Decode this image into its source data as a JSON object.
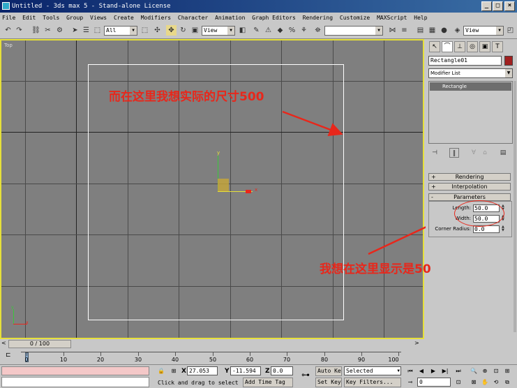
{
  "window": {
    "title": "Untitled - 3ds max 5 - Stand-alone License",
    "min": "_",
    "max": "□",
    "close": "×"
  },
  "menu": [
    "File",
    "Edit",
    "Tools",
    "Group",
    "Views",
    "Create",
    "Modifiers",
    "Character",
    "Animation",
    "Graph Editors",
    "Rendering",
    "Customize",
    "MAXScript",
    "Help"
  ],
  "toolbar": {
    "selection_filter": "All",
    "ref_coord": "View",
    "ref_coord_right": "View"
  },
  "viewport": {
    "label": "Top",
    "axis_x": "x",
    "axis_y": "y"
  },
  "annotations": {
    "top": "而在这里我想实际的尺寸500",
    "bottom": "我想在这里显示是50"
  },
  "command_panel": {
    "object_name": "Rectangle01",
    "modifier_list": "Modifier List",
    "stack_item": "Rectangle",
    "rollouts": {
      "rendering": "Rendering",
      "interpolation": "Interpolation",
      "parameters": "Parameters"
    },
    "params": {
      "length_label": "Length:",
      "length_value": "50.0",
      "width_label": "Width:",
      "width_value": "50.0",
      "corner_label": "Corner Radius:",
      "corner_value": "0.0"
    }
  },
  "trackbar": {
    "slider": "0 / 100",
    "ticks": [
      "0",
      "10",
      "20",
      "30",
      "40",
      "50",
      "60",
      "70",
      "80",
      "90",
      "100"
    ]
  },
  "status": {
    "x_label": "X",
    "x_value": "27.053",
    "y_label": "Y",
    "y_value": "-11.594",
    "z_label": "Z",
    "z_value": "0.0",
    "prompt": "Click and drag to select",
    "add_time_tag": "Add Time Tag",
    "auto_key": "Auto Key",
    "set_key": "Set Key",
    "selected": "Selected",
    "key_filters": "Key Filters...",
    "frame": "0"
  },
  "colors": {
    "viewport_bg": "#7f7f7f",
    "active_border": "#e6e03a",
    "annotation": "#e8271b"
  }
}
